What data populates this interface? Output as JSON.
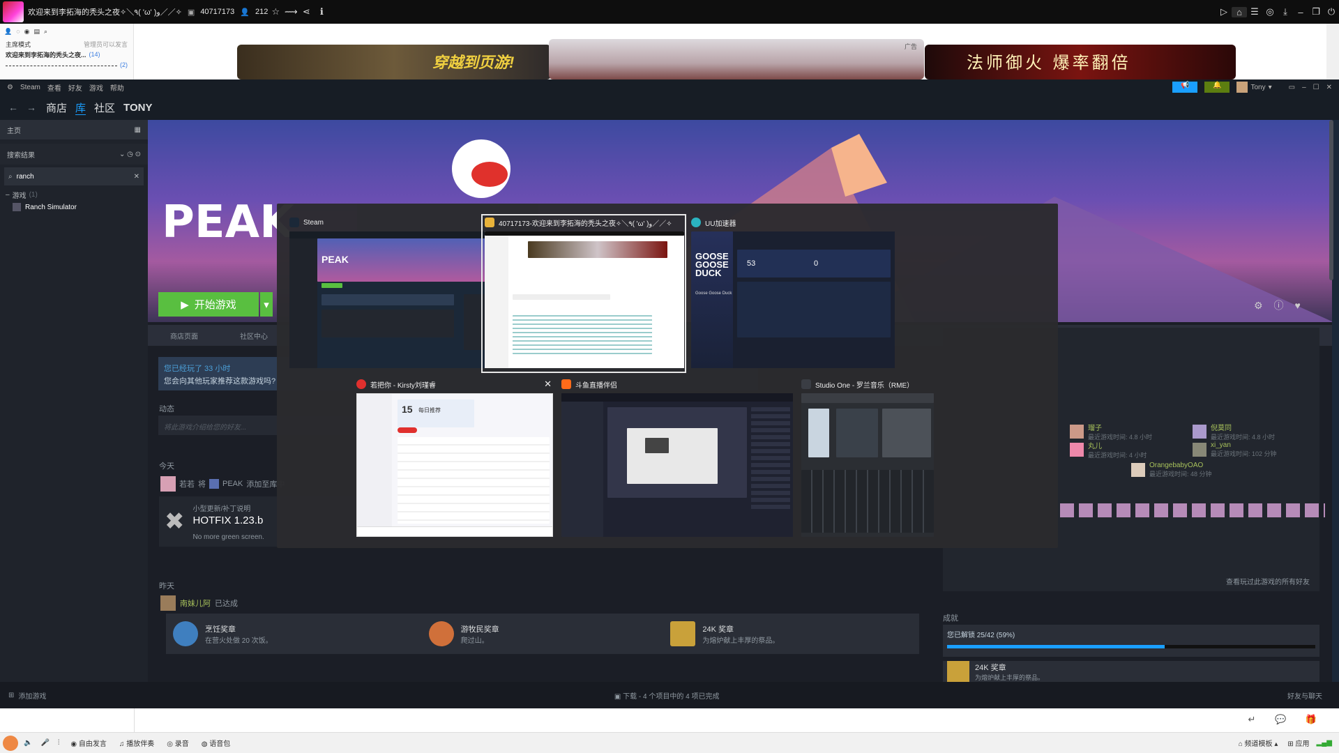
{
  "stream_client": {
    "title": "欢迎来到李拓海的秃头之夜✧＼٩( 'ω' )و／／✧",
    "room_id": "40717173",
    "viewers": "212"
  },
  "web": {
    "left_header": "主席模式",
    "left_header_note": "管理员可以发言",
    "left_item1": "欢迎来到李拓海的秃头之夜...",
    "left_item1_count": "(14)",
    "left_item2_count": "(2)",
    "banner3_text": "法师御火  爆率翻倍",
    "banner1_text": "穿越到页游!",
    "ad_label": "广告"
  },
  "steam": {
    "menu": [
      "Steam",
      "查看",
      "好友",
      "游戏",
      "帮助"
    ],
    "nav": [
      "商店",
      "库",
      "社区",
      "TONY"
    ],
    "nav_active": "库",
    "user": "Tony",
    "home_label": "主页",
    "filter_label": "搜索结果",
    "search_value": "ranch",
    "games_header": "游戏",
    "games_count": "(1)",
    "game_item": "Ranch Simulator",
    "game_title": "PEAK",
    "play_button": "开始游戏",
    "tabs": [
      "商店页面",
      "社区中心"
    ],
    "played_title": "您已经玩了 33 小时",
    "played_question": "您会向其他玩家推荐这款游戏吗?",
    "activity_label": "动态",
    "activity_placeholder": "将此游戏介绍给您的好友...",
    "today_label": "今天",
    "today_user": "若若",
    "today_action": "将",
    "today_game": "PEAK",
    "today_rest": "添加至库中",
    "update_type": "小型更新/补丁说明",
    "update_title": "HOTFIX 1.23.b",
    "update_desc": "No more green screen.",
    "yesterday_label": "昨天",
    "yesterday_user": "南妹儿阿",
    "yesterday_action": "已达成",
    "achievements": [
      {
        "name": "烹饪奖章",
        "desc": "在营火处做 20 次饭。",
        "color": "#3f7fbf"
      },
      {
        "name": "游牧民奖章",
        "desc": "爬过山。",
        "color": "#d0703a"
      },
      {
        "name": "24K 奖章",
        "desc": "为熔炉献上丰厚的祭品。",
        "color": "#c9a13a"
      }
    ],
    "friends": [
      {
        "name": "瑠子",
        "sub": "最近游戏时间: 4.8 小时"
      },
      {
        "name": "丸儿",
        "sub": "最近游戏时间: 4 小时"
      },
      {
        "name": "倪莫同",
        "sub": "最近游戏时间: 4.8 小时"
      },
      {
        "name": "xi_yan",
        "sub": "最近游戏时间: 102 分钟"
      },
      {
        "name": "OrangebabyOAO",
        "sub": "最近游戏时间: 48 分钟"
      }
    ],
    "friends_more": "查看玩过此游戏的所有好友",
    "achievements_label": "成就",
    "achievement_progress_text": "您已解锁 25/42 (59%)",
    "achievement_progress": 0.59,
    "ach_last_name": "24K 奖章",
    "ach_last_desc": "为熔炉献上丰厚的祭品。",
    "add_game": "添加游戏",
    "downloads": "下载 - 4 个项目中的 4 项已完成",
    "friends_chat": "好友与聊天"
  },
  "alttab": {
    "tiles": [
      {
        "title": "Steam",
        "icon_color": "#1b2838"
      },
      {
        "title": "40717173-欢迎来到李拓海的秃头之夜✧＼٩( 'ω' )و／／✧",
        "icon_color": "#e8b23a"
      },
      {
        "title": "UU加速器",
        "icon_color": "#2bb3c0"
      },
      {
        "title": "若把你 - Kirsty刘瑾睿",
        "icon_color": "#e0302e"
      },
      {
        "title": "斗鱼直播伴侣",
        "icon_color": "#ff6b1a"
      },
      {
        "title": "Studio One - 罗兰音乐（RME）",
        "icon_color": "#3a3d44"
      }
    ],
    "selected_index": 1,
    "thumb_peak": "PEAK",
    "thumb_goose": "GOOSE GOOSE DUCK",
    "thumb_goose_caption": "Goose Goose Duck",
    "thumb_music_count": "15",
    "thumb_music_caption": "每日推荐",
    "thumb_uu_val1": "53",
    "thumb_uu_val2": "0"
  },
  "taskbar": {
    "items": [
      "自由发言",
      "播放伴奏",
      "录音",
      "语音包"
    ],
    "right_items": [
      "频道模板",
      "应用"
    ]
  }
}
